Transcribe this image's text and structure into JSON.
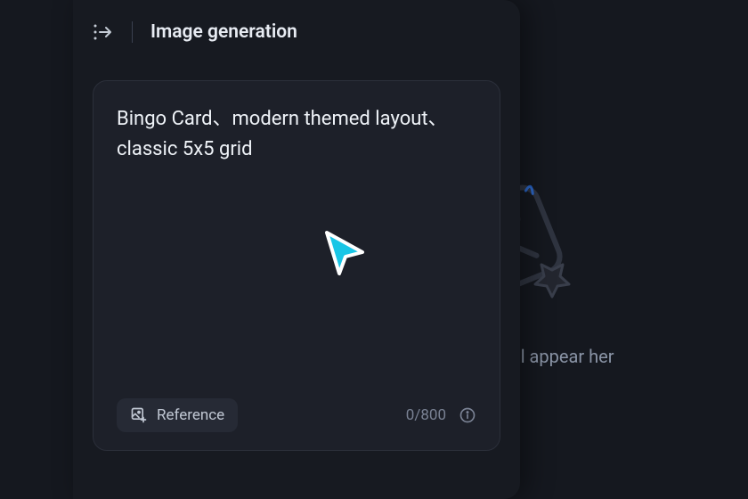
{
  "header": {
    "title": "Image generation"
  },
  "prompt": {
    "text": "Bingo Card、modern themed layout、classic 5x5 grid",
    "char_count": "0/800"
  },
  "reference": {
    "label": "Reference"
  },
  "background": {
    "message": "ated results will appear her"
  }
}
